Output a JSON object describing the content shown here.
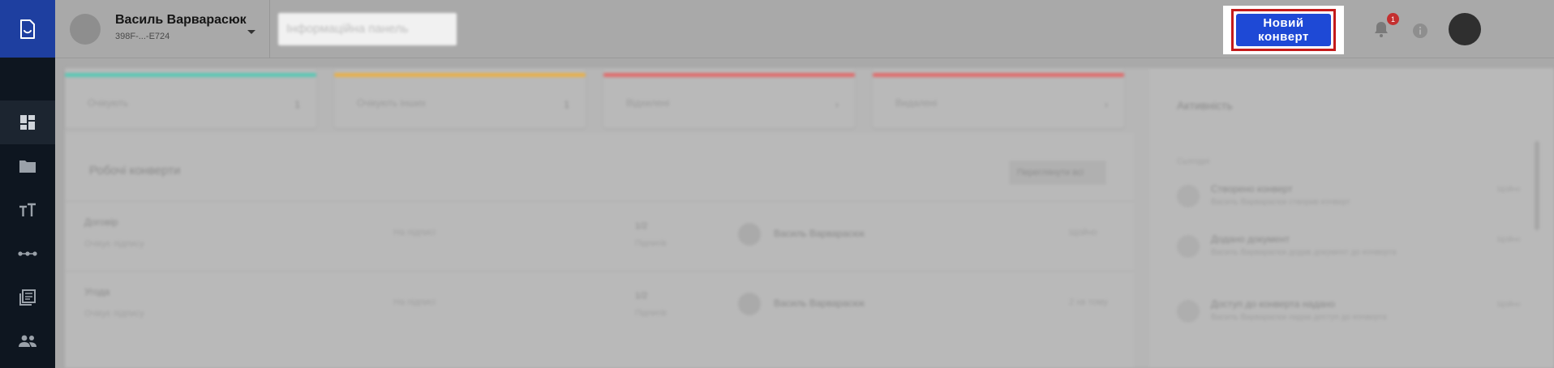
{
  "sidebar": {
    "logo_icon": "document-logo-icon",
    "items": [
      {
        "name": "dashboard",
        "icon": "dashboard-icon",
        "active": true
      },
      {
        "name": "folders",
        "icon": "folder-icon",
        "active": false
      },
      {
        "name": "text",
        "icon": "text-size-icon",
        "active": false
      },
      {
        "name": "connections",
        "icon": "connection-dots-icon",
        "active": false
      },
      {
        "name": "library",
        "icon": "library-icon",
        "active": false
      },
      {
        "name": "contacts",
        "icon": "people-icon",
        "active": false
      }
    ],
    "colors": {
      "rail": "#0e1620",
      "logo_bg": "#1e3fa0"
    }
  },
  "header": {
    "user": {
      "name": "Василь Варварасюк",
      "id": "398F-...-E724"
    },
    "panel_chip": "Інформаційна панель",
    "new_envelope_label": "Новий конверт",
    "notifications_count": "1",
    "colors": {
      "accent": "#1e49d6",
      "highlight": "#c41a1a",
      "badge": "#c43030"
    }
  },
  "main": {
    "filters": [
      {
        "placeholder": "Очікують",
        "mark": "1",
        "color": "#5ac7b4"
      },
      {
        "placeholder": "Очікують інших",
        "mark": "1",
        "color": "#e8b04a"
      },
      {
        "placeholder": "Відхилені",
        "mark": "›",
        "color": "#e06b6b"
      },
      {
        "placeholder": "Видалені",
        "mark": "›",
        "color": "#e06b6b"
      }
    ],
    "documents": {
      "title": "Робочі конверти",
      "action_label": "Переглянути всі",
      "rows": [
        {
          "name": "Договір",
          "type": "Очікує підпису",
          "status": "На підписі",
          "count": "1/2",
          "count_label": "Підписів",
          "owner": "Василь Варварасюк",
          "time": "Щойно"
        },
        {
          "name": "Угода",
          "type": "Очікує підпису",
          "status": "На підписі",
          "count": "1/2",
          "count_label": "Підписів",
          "owner": "Василь Варварасюк",
          "time": "2 хв тому"
        }
      ]
    },
    "activity": {
      "title": "Активність",
      "section": "Сьогодні",
      "items": [
        {
          "title": "Створено конверт",
          "desc": "Василь Варварасюк створив конверт",
          "time": "Щойно"
        },
        {
          "title": "Додано документ",
          "desc": "Василь Варварасюк додав документ до конверта",
          "time": "Щойно"
        },
        {
          "title": "Доступ до конверта надано",
          "desc": "Василь Варварасюк надав доступ до конверта",
          "time": "Щойно"
        }
      ]
    }
  }
}
